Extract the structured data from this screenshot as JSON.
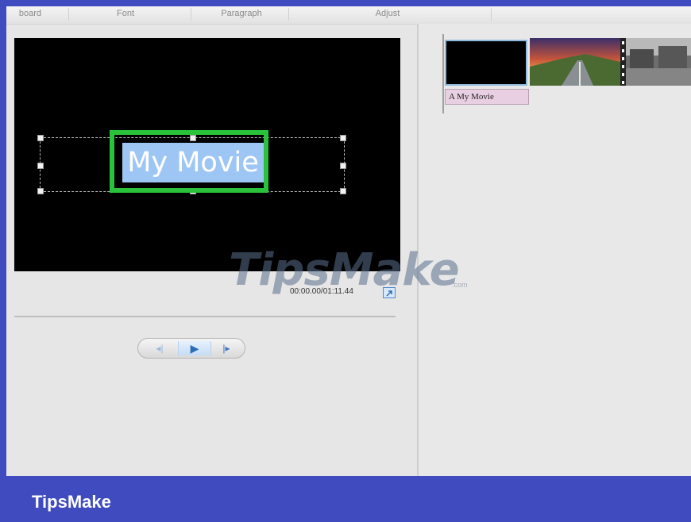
{
  "ribbon": {
    "groups": [
      "board",
      "Font",
      "Paragraph",
      "Adjust"
    ]
  },
  "preview": {
    "title_text": "My Movie",
    "timecode": "00:00.00/01:11.44"
  },
  "transport": {
    "prev_glyph": "◂|",
    "play_glyph": "▶",
    "next_glyph": "|▸"
  },
  "timeline": {
    "clip_caption": "A My Movie"
  },
  "watermark": {
    "brand": "TipsMake",
    "suffix": ".com"
  },
  "footer": {
    "brand": "TipsMake"
  },
  "colors": {
    "frame": "#3f4bbf",
    "highlight_box": "#29c23a",
    "text_selection": "#9ec6f4",
    "caption_bg": "#e8cfe2"
  }
}
